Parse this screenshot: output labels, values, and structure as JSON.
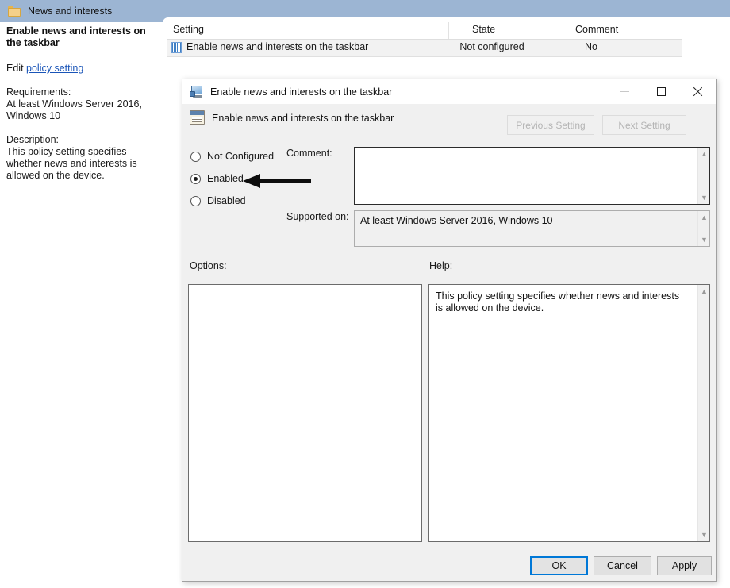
{
  "group_header": {
    "icon": "folder-icon",
    "label": "News and interests"
  },
  "list": {
    "columns": [
      "Setting",
      "State",
      "Comment"
    ],
    "rows": [
      {
        "icon": "policy-setting-icon",
        "setting": "Enable news and interests on the taskbar",
        "state": "Not configured",
        "comment": "No"
      }
    ]
  },
  "sidebar": {
    "title": "Enable news and interests on the taskbar",
    "edit_prefix": "Edit",
    "edit_link": "policy setting",
    "requirements_label": "Requirements:",
    "requirements_value": "At least Windows Server 2016, Windows 10",
    "description_label": "Description:",
    "description_value": "This policy setting specifies whether news and interests is allowed on the device."
  },
  "dialog": {
    "title": "Enable news and interests on the taskbar",
    "app_icon": "computer-policy-icon",
    "window_buttons": {
      "minimize": "minimize-icon",
      "maximize": "maximize-icon",
      "close": "close-icon"
    },
    "header": {
      "icon": "policy-document-icon",
      "label": "Enable news and interests on the taskbar",
      "previous_setting": "Previous Setting",
      "next_setting": "Next Setting"
    },
    "state_options": [
      {
        "label": "Not Configured",
        "selected": false
      },
      {
        "label": "Enabled",
        "selected": true
      },
      {
        "label": "Disabled",
        "selected": false
      }
    ],
    "comment": {
      "label": "Comment:",
      "value": "",
      "placeholder": ""
    },
    "supported_on": {
      "label": "Supported on:",
      "value": "At least Windows Server 2016, Windows 10"
    },
    "options": {
      "label": "Options:",
      "value": ""
    },
    "help": {
      "label": "Help:",
      "value": "This policy setting specifies whether news and interests is allowed on the device."
    },
    "footer": {
      "ok": "OK",
      "cancel": "Cancel",
      "apply": "Apply"
    }
  },
  "annotation": {
    "arrow": "left-pointing-arrow",
    "points_at": "Enabled"
  },
  "colors": {
    "band_blue": "#9cb5d3",
    "link_blue": "#1a55b8",
    "focus_blue": "#0078d7",
    "dialog_bg": "#f0f0f0"
  }
}
